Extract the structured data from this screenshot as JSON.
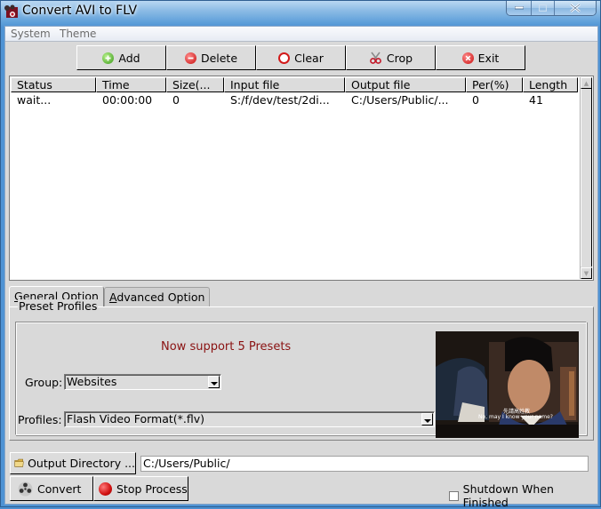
{
  "window": {
    "title": "Convert AVI to FLV",
    "controls": [
      "minimize",
      "maximize",
      "close"
    ]
  },
  "menu": {
    "items": [
      {
        "label": "System"
      },
      {
        "label": "Theme"
      }
    ]
  },
  "toolbar": {
    "buttons": [
      {
        "label": "Add",
        "icon": "add-icon"
      },
      {
        "label": "Delete",
        "icon": "delete-icon"
      },
      {
        "label": "Clear",
        "icon": "clear-icon"
      },
      {
        "label": "Crop",
        "icon": "scissors-icon"
      },
      {
        "label": "Exit",
        "icon": "exit-icon"
      }
    ]
  },
  "file_list": {
    "columns": [
      "Status",
      "Time",
      "Size(...",
      "Input file",
      "Output file",
      "Per(%)",
      "Length"
    ],
    "rows": [
      {
        "status": "wait...",
        "time": "00:00:00",
        "size": "0",
        "input_file": "S:/f/dev/test/2di...",
        "output_file": "C:/Users/Public/...",
        "percent": "0",
        "length": "41"
      }
    ]
  },
  "tabs": [
    {
      "label": "General Option",
      "mnemonic": "G",
      "rest": "eneral Option",
      "active": true
    },
    {
      "label": "Advanced Option",
      "mnemonic": "A",
      "rest": "dvanced Option",
      "active": false
    }
  ],
  "preset_profiles": {
    "title": "Preset Profiles",
    "note": "Now support 5 Presets",
    "group_label": "Group:",
    "group_value": "Websites",
    "profiles_label": "Profiles:",
    "profiles_value": "Flash Video Format(*.flv)",
    "preview_subtitle_cn": "先請高姓教",
    "preview_subtitle_en": "No, may I know your name?"
  },
  "output": {
    "directory_button": "Output Directory ...",
    "directory_value": "C:/Users/Public/"
  },
  "actions": {
    "convert": "Convert",
    "stop": "Stop Process",
    "shutdown_label": "Shutdown When Finished",
    "shutdown_checked": false
  },
  "colors": {
    "note_text": "#8a1212",
    "titlebar": "#5fa0da",
    "panel_bg": "#d9d9d9"
  }
}
